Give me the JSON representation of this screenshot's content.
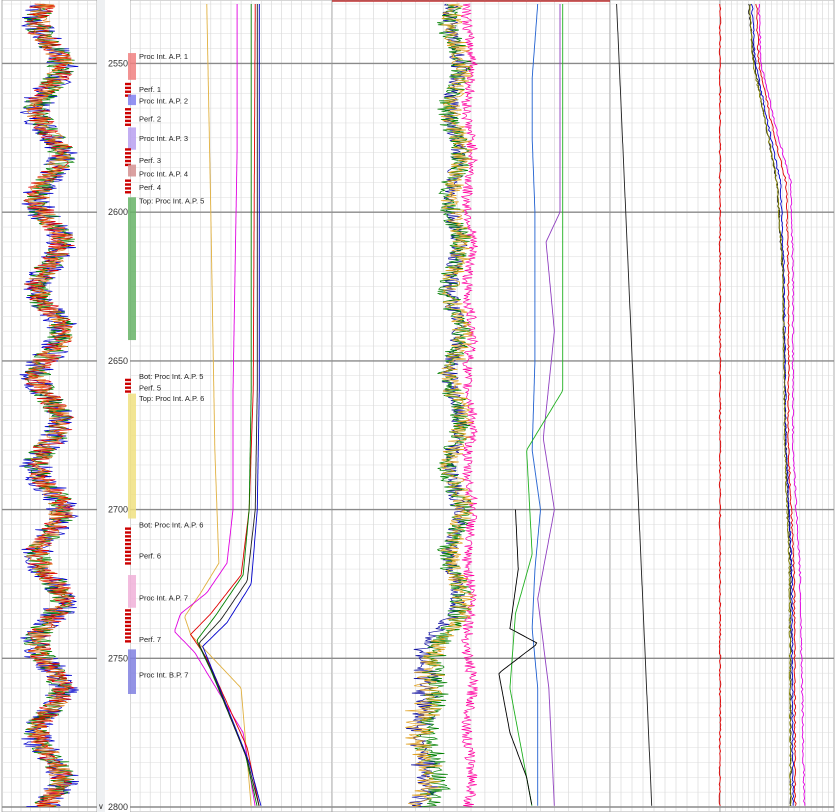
{
  "chart_data": {
    "type": "line",
    "depth_axis": {
      "range": [
        2530,
        2800
      ],
      "tick_labels": [
        "2550",
        "2600",
        "2650",
        "2700",
        "2750",
        "2800"
      ]
    },
    "intervals": [
      {
        "label": "Proc Int. A.P. 1",
        "top": 2546.5,
        "bottom": 2555.5,
        "color": "#f08080",
        "label_depth": 2547.5
      },
      {
        "label": "Perf. 1",
        "top": 2556.5,
        "bottom": 2560.5,
        "color": "#cc0000",
        "label_depth": 2558.5,
        "perf": true
      },
      {
        "label": "Proc Int. A.P. 2",
        "top": 2560.5,
        "bottom": 2564.0,
        "color": "#8080f0",
        "label_depth": 2562.5
      },
      {
        "label": "Perf. 2",
        "top": 2565.0,
        "bottom": 2570.5,
        "color": "#cc0000",
        "label_depth": 2568.5,
        "perf": true
      },
      {
        "label": "Proc Int. A.P. 3",
        "top": 2571.5,
        "bottom": 2579.0,
        "color": "#b8a0f0",
        "label_depth": 2575.0
      },
      {
        "label": "Perf. 3",
        "top": 2578.5,
        "bottom": 2584.0,
        "color": "#cc0000",
        "label_depth": 2582.5,
        "perf": true
      },
      {
        "label": "Proc Int. A.P. 4",
        "top": 2584.0,
        "bottom": 2588.0,
        "color": "#d49090",
        "label_depth": 2587.0
      },
      {
        "label": "Perf. 4",
        "top": 2589.0,
        "bottom": 2593.0,
        "color": "#cc0000",
        "label_depth": 2591.5,
        "perf": true
      },
      {
        "label": "Top: Proc Int. A.P. 5",
        "top": 2595.0,
        "bottom": 2643.0,
        "color": "#66b366",
        "label_depth": 2596.0
      },
      {
        "label": "Bot: Proc Int. A.P. 5",
        "top": null,
        "bottom": null,
        "color": "#66b366",
        "label_depth": 2655.0
      },
      {
        "label": "Perf. 5",
        "top": 2656.0,
        "bottom": 2660.0,
        "color": "#cc0000",
        "label_depth": 2659.0,
        "perf": true
      },
      {
        "label": "Top: Proc Int. A.P. 6",
        "top": 2661.0,
        "bottom": 2703.0,
        "color": "#f0e080",
        "label_depth": 2662.5
      },
      {
        "label": "Bot: Proc Int. A.P. 6",
        "top": null,
        "bottom": null,
        "color": "#f0e080",
        "label_depth": 2705.0
      },
      {
        "label": "Perf. 6",
        "top": 2706.0,
        "bottom": 2718.0,
        "color": "#cc0000",
        "label_depth": 2715.5,
        "perf": true
      },
      {
        "label": "Proc Int. A.P. 7",
        "top": 2722.0,
        "bottom": 2733.0,
        "color": "#f0b0d8",
        "label_depth": 2729.5
      },
      {
        "label": "Perf. 7",
        "top": 2733.5,
        "bottom": 2744.0,
        "color": "#cc0000",
        "label_depth": 2743.5,
        "perf": true
      },
      {
        "label": "Proc Int. B.P. 7",
        "top": 2747.0,
        "bottom": 2762.0,
        "color": "#8080e0",
        "label_depth": 2755.5
      }
    ],
    "tracks": [
      {
        "name": "",
        "series": [
          {
            "name": "",
            "color": "#0000cc",
            "kind": "noise",
            "range": [
              0.15,
              0.85
            ],
            "noise": 0.18
          },
          {
            "name": "",
            "color": "#008000",
            "kind": "noise",
            "range": [
              0.18,
              0.82
            ],
            "noise": 0.15
          },
          {
            "name": "",
            "color": "#e00000",
            "kind": "noise",
            "range": [
              0.18,
              0.82
            ],
            "noise": 0.14
          },
          {
            "name": "",
            "color": "#e07820",
            "kind": "noise",
            "range": [
              0.2,
              0.8
            ],
            "noise": 0.13
          }
        ]
      },
      {
        "name": "",
        "series": [
          {
            "name": "",
            "color": "#e0b040",
            "points": [
              [
                2530,
                0.38
              ],
              [
                2600,
                0.4
              ],
              [
                2680,
                0.42
              ],
              [
                2718,
                0.44
              ],
              [
                2728,
                0.35
              ],
              [
                2736,
                0.27
              ],
              [
                2742,
                0.3
              ],
              [
                2760,
                0.55
              ],
              [
                2800,
                0.6
              ]
            ]
          },
          {
            "name": "",
            "color": "#e000e0",
            "points": [
              [
                2530,
                0.53
              ],
              [
                2580,
                0.53
              ],
              [
                2620,
                0.52
              ],
              [
                2660,
                0.51
              ],
              [
                2700,
                0.51
              ],
              [
                2718,
                0.48
              ],
              [
                2728,
                0.38
              ],
              [
                2735,
                0.25
              ],
              [
                2741,
                0.22
              ],
              [
                2748,
                0.32
              ],
              [
                2775,
                0.56
              ],
              [
                2800,
                0.62
              ]
            ]
          },
          {
            "name": "",
            "color": "#e00000",
            "points": [
              [
                2530,
                0.62
              ],
              [
                2660,
                0.61
              ],
              [
                2700,
                0.59
              ],
              [
                2722,
                0.55
              ],
              [
                2735,
                0.4
              ],
              [
                2742,
                0.3
              ],
              [
                2750,
                0.38
              ],
              [
                2780,
                0.58
              ],
              [
                2800,
                0.64
              ]
            ]
          },
          {
            "name": "",
            "color": "#008000",
            "points": [
              [
                2530,
                0.6
              ],
              [
                2660,
                0.6
              ],
              [
                2700,
                0.59
              ],
              [
                2722,
                0.56
              ],
              [
                2736,
                0.42
              ],
              [
                2744,
                0.33
              ],
              [
                2754,
                0.4
              ],
              [
                2782,
                0.57
              ],
              [
                2800,
                0.63
              ]
            ]
          },
          {
            "name": "",
            "color": "#0000cc",
            "points": [
              [
                2530,
                0.64
              ],
              [
                2660,
                0.64
              ],
              [
                2700,
                0.63
              ],
              [
                2725,
                0.6
              ],
              [
                2738,
                0.48
              ],
              [
                2746,
                0.36
              ],
              [
                2756,
                0.42
              ],
              [
                2785,
                0.59
              ],
              [
                2800,
                0.65
              ]
            ]
          },
          {
            "name": "",
            "color": "#202020",
            "points": [
              [
                2530,
                0.63
              ],
              [
                2660,
                0.63
              ],
              [
                2700,
                0.62
              ],
              [
                2724,
                0.58
              ],
              [
                2737,
                0.45
              ],
              [
                2745,
                0.34
              ],
              [
                2755,
                0.41
              ],
              [
                2784,
                0.58
              ],
              [
                2800,
                0.64
              ]
            ]
          }
        ]
      },
      {
        "name": "",
        "series": [
          {
            "name": "",
            "color": "#2060d0",
            "points": [
              [
                2530,
                0.74
              ],
              [
                2555,
                0.72
              ],
              [
                2575,
                0.72
              ],
              [
                2600,
                0.73
              ],
              [
                2650,
                0.73
              ],
              [
                2680,
                0.72
              ],
              [
                2700,
                0.75
              ],
              [
                2720,
                0.73
              ],
              [
                2740,
                0.72
              ],
              [
                2760,
                0.74
              ],
              [
                2800,
                0.74
              ]
            ]
          },
          {
            "name": "",
            "color": "#1010a0",
            "kind": "noise",
            "range": [
              0.4,
              0.48
            ],
            "noise": 0.03,
            "ramp": [
              2735,
              0.3
            ]
          },
          {
            "name": "",
            "color": "#ff00a0",
            "kind": "noise",
            "range": [
              0.47,
              0.52
            ],
            "noise": 0.02
          },
          {
            "name": "",
            "color": "#008000",
            "kind": "noise",
            "range": [
              0.38,
              0.5
            ],
            "noise": 0.04,
            "ramp": [
              2740,
              0.34
            ]
          },
          {
            "name": "",
            "color": "#e0a020",
            "kind": "noise",
            "range": [
              0.4,
              0.5
            ],
            "noise": 0.04,
            "ramp": [
              2740,
              0.3
            ]
          },
          {
            "name": "",
            "color": "#9040c0",
            "points": [
              [
                2530,
                0.82
              ],
              [
                2600,
                0.82
              ],
              [
                2610,
                0.77
              ],
              [
                2640,
                0.8
              ],
              [
                2676,
                0.76
              ],
              [
                2700,
                0.8
              ],
              [
                2730,
                0.74
              ],
              [
                2760,
                0.78
              ],
              [
                2800,
                0.8
              ]
            ]
          },
          {
            "name": "",
            "color": "#20b020",
            "points": [
              [
                2530,
                0.83
              ],
              [
                2660,
                0.83
              ],
              [
                2680,
                0.7
              ],
              [
                2715,
                0.72
              ],
              [
                2735,
                0.66
              ],
              [
                2760,
                0.64
              ],
              [
                2790,
                0.7
              ],
              [
                2800,
                0.72
              ]
            ]
          },
          {
            "name": "",
            "color": "#000000",
            "points": [
              [
                2700,
                0.66
              ],
              [
                2720,
                0.67
              ],
              [
                2740,
                0.64
              ],
              [
                2745,
                0.74
              ],
              [
                2755,
                0.6
              ],
              [
                2775,
                0.64
              ],
              [
                2790,
                0.7
              ],
              [
                2800,
                0.72
              ]
            ]
          }
        ]
      },
      {
        "name": "",
        "series": [
          {
            "name": "",
            "color": "#202020",
            "points": [
              [
                2530,
                0.06
              ],
              [
                2800,
                0.38
              ]
            ]
          }
        ]
      },
      {
        "name": "",
        "series": [
          {
            "name": "",
            "color": "#e00000",
            "points": [
              [
                2530,
                0.0
              ],
              [
                2800,
                0.0
              ]
            ]
          },
          {
            "name": "",
            "color": "#202020",
            "points": [
              [
                2530,
                0.25
              ],
              [
                2550,
                0.3
              ],
              [
                2570,
                0.4
              ],
              [
                2590,
                0.5
              ],
              [
                2620,
                0.55
              ],
              [
                2680,
                0.58
              ],
              [
                2720,
                0.62
              ],
              [
                2800,
                0.62
              ]
            ]
          },
          {
            "name": "",
            "color": "#e00000",
            "points": [
              [
                2530,
                0.32
              ],
              [
                2550,
                0.34
              ],
              [
                2570,
                0.45
              ],
              [
                2590,
                0.58
              ],
              [
                2620,
                0.6
              ],
              [
                2680,
                0.6
              ],
              [
                2720,
                0.65
              ],
              [
                2800,
                0.66
              ]
            ]
          },
          {
            "name": "",
            "color": "#0000cc",
            "points": [
              [
                2530,
                0.28
              ],
              [
                2550,
                0.31
              ],
              [
                2570,
                0.42
              ],
              [
                2590,
                0.53
              ],
              [
                2620,
                0.56
              ],
              [
                2680,
                0.58
              ],
              [
                2720,
                0.63
              ],
              [
                2800,
                0.64
              ]
            ]
          },
          {
            "name": "",
            "color": "#e000e0",
            "points": [
              [
                2530,
                0.34
              ],
              [
                2550,
                0.36
              ],
              [
                2570,
                0.48
              ],
              [
                2590,
                0.62
              ],
              [
                2620,
                0.64
              ],
              [
                2680,
                0.64
              ],
              [
                2720,
                0.7
              ],
              [
                2800,
                0.74
              ]
            ]
          },
          {
            "name": "",
            "color": "#808000",
            "points": [
              [
                2530,
                0.26
              ],
              [
                2550,
                0.29
              ],
              [
                2570,
                0.4
              ],
              [
                2590,
                0.5
              ],
              [
                2620,
                0.55
              ],
              [
                2680,
                0.57
              ],
              [
                2720,
                0.61
              ],
              [
                2800,
                0.62
              ]
            ]
          }
        ]
      }
    ],
    "grid": true
  }
}
